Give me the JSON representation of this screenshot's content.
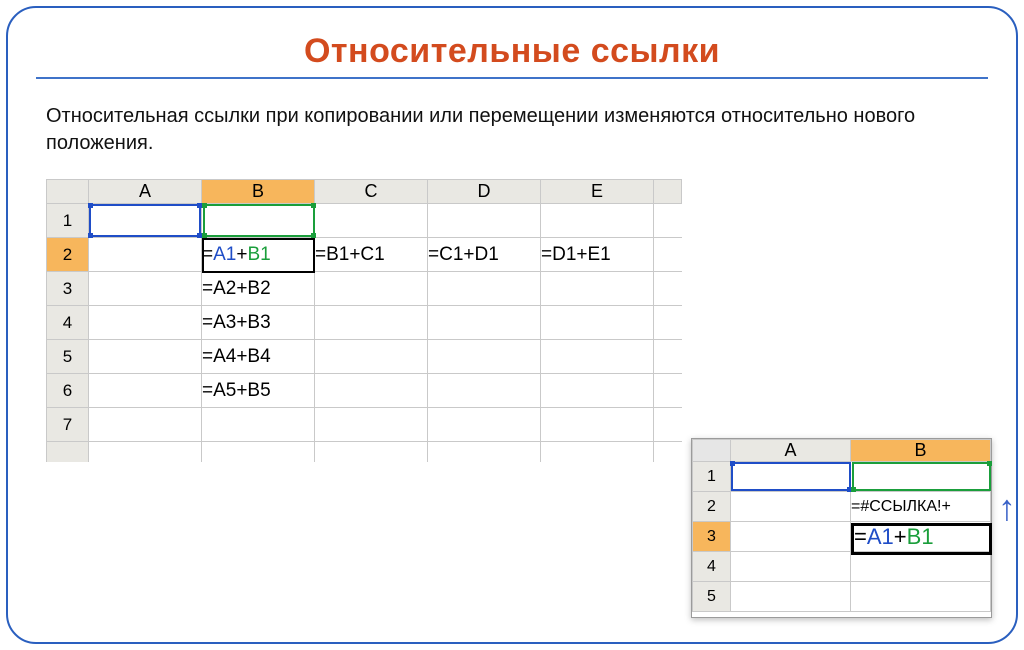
{
  "title": "Относительные ссылки",
  "description": "Относительная ссылки при копировании или перемещении изменяются относительно нового положения.",
  "mainSheet": {
    "columns": [
      "A",
      "B",
      "C",
      "D",
      "E"
    ],
    "rows": [
      "1",
      "2",
      "3",
      "4",
      "5",
      "6",
      "7"
    ],
    "b2_ref1": "A1",
    "b2_plus": "+",
    "b2_ref2": "B1",
    "b2_eq": "=",
    "c2": "=B1+C1",
    "d2": "=C1+D1",
    "e2": "=D1+E1",
    "b3": "=A2+B2",
    "b4": "=A3+B3",
    "b5": "=A4+B4",
    "b6": "=A5+B5"
  },
  "smallSheet": {
    "columns": [
      "A",
      "B"
    ],
    "rows": [
      "1",
      "2",
      "3",
      "4",
      "5"
    ],
    "b2": "=#ССЫЛКА!+",
    "b3_eq": "=",
    "b3_ref1": "A1",
    "b3_plus": "+",
    "b3_ref2": "B1"
  }
}
